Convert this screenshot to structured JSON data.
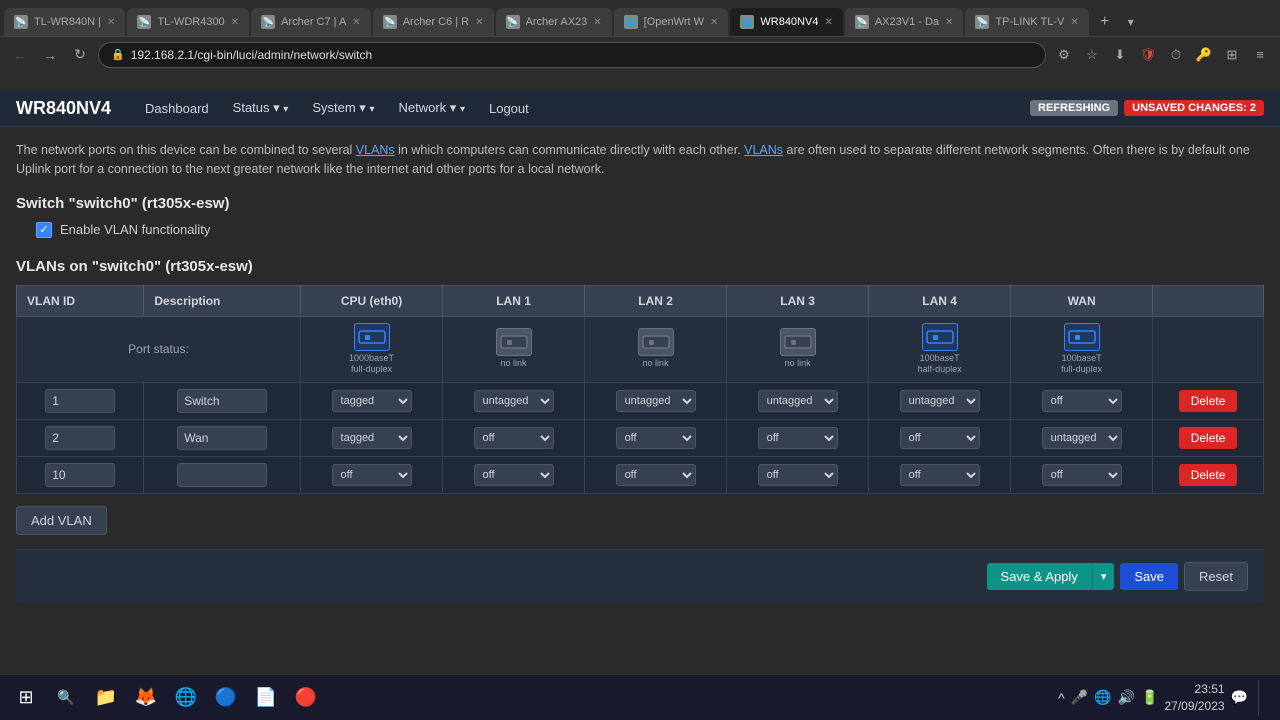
{
  "browser": {
    "address": "192.168.2.1/cgi-bin/luci/admin/network/switch",
    "tabs": [
      {
        "id": "tab-tlwr840n",
        "label": "TL-WR840N |",
        "icon": "📡",
        "active": false
      },
      {
        "id": "tab-tlwdr4300",
        "label": "TL-WDR4300",
        "icon": "📡",
        "active": false
      },
      {
        "id": "tab-archerc7",
        "label": "Archer C7 | A",
        "icon": "📡",
        "active": false
      },
      {
        "id": "tab-archerc6",
        "label": "Archer C6 | R",
        "icon": "📡",
        "active": false
      },
      {
        "id": "tab-archeraz23",
        "label": "Archer AX23",
        "icon": "📡",
        "active": false
      },
      {
        "id": "tab-openwrt",
        "label": "[OpenWrt W",
        "icon": "🌐",
        "active": false
      },
      {
        "id": "tab-wr840nv4",
        "label": "WR840NV4",
        "icon": "🌐",
        "active": true
      },
      {
        "id": "tab-ax23v1",
        "label": "AX23V1 - Da",
        "icon": "📡",
        "active": false
      },
      {
        "id": "tab-tplink",
        "label": "TP-LINK TL-V",
        "icon": "📡",
        "active": false
      }
    ]
  },
  "luci": {
    "brand": "WR840NV4",
    "nav": [
      {
        "label": "Dashboard",
        "hasArrow": false
      },
      {
        "label": "Status",
        "hasArrow": true
      },
      {
        "label": "System",
        "hasArrow": true
      },
      {
        "label": "Network",
        "hasArrow": true
      },
      {
        "label": "Logout",
        "hasArrow": false
      }
    ],
    "badges": {
      "refreshing": "REFRESHING",
      "unsaved": "UNSAVED CHANGES: 2"
    }
  },
  "page": {
    "description": "The network ports on this device can be combined to several VLANs in which computers can communicate directly with each other. VLANs are often used to separate different network segments. Often there is by default one Uplink port for a connection to the next greater network like the internet and other ports for a local network.",
    "switch_section": "Switch \"switch0\" (rt305x-esw)",
    "vlan_enable_label": "Enable VLAN functionality",
    "vlans_section": "VLANs on \"switch0\" (rt305x-esw)",
    "columns": [
      "VLAN ID",
      "Description",
      "CPU (eth0)",
      "LAN 1",
      "LAN 2",
      "LAN 3",
      "LAN 4",
      "WAN"
    ],
    "port_status_label": "Port status:",
    "ports": [
      {
        "name": "CPU (eth0)",
        "status_line1": "1000baseT",
        "status_line2": "full-duplex",
        "active": true
      },
      {
        "name": "LAN 1",
        "status_line1": "no link",
        "status_line2": "",
        "active": false
      },
      {
        "name": "LAN 2",
        "status_line1": "no link",
        "status_line2": "",
        "active": false
      },
      {
        "name": "LAN 3",
        "status_line1": "no link",
        "status_line2": "",
        "active": false
      },
      {
        "name": "LAN 4",
        "status_line1": "100baseT",
        "status_line2": "half-duplex",
        "active": true
      },
      {
        "name": "WAN",
        "status_line1": "100baseT",
        "status_line2": "full-duplex",
        "active": true
      }
    ],
    "vlans": [
      {
        "id": "1",
        "description": "Switch",
        "cpu": "tagged",
        "lan1": "untagg",
        "lan2": "untagg",
        "lan3": "untagg",
        "lan4": "untagge",
        "wan": "off"
      },
      {
        "id": "2",
        "description": "Wan",
        "cpu": "tagged",
        "lan1": "off",
        "lan2": "off",
        "lan3": "off",
        "lan4": "off",
        "wan": "untagge"
      },
      {
        "id": "10",
        "description": "",
        "cpu": "off",
        "lan1": "off",
        "lan2": "off",
        "lan3": "off",
        "lan4": "off",
        "wan": "off"
      }
    ],
    "cpu_options": [
      "tagged",
      "untagged",
      "off"
    ],
    "port_options": [
      "untagged",
      "tagged",
      "off"
    ],
    "add_vlan_label": "Add VLAN",
    "delete_label": "Delete"
  },
  "actions": {
    "save_apply_label": "Save & Apply",
    "save_label": "Save",
    "reset_label": "Reset"
  },
  "taskbar": {
    "clock_time": "23:51",
    "clock_date": "27/09/2023"
  }
}
